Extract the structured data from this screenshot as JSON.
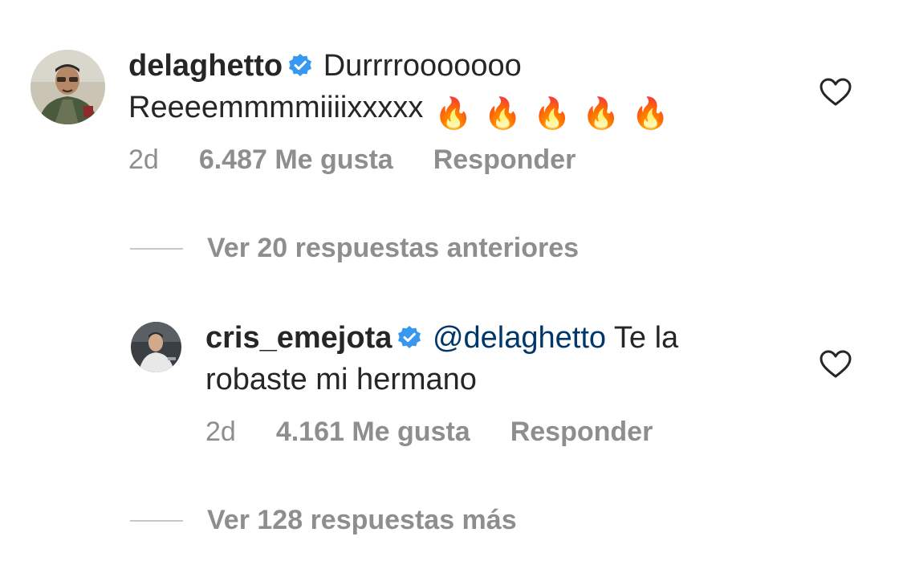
{
  "comments": [
    {
      "username": "delaghetto",
      "verified": true,
      "line1_text": "Durrrrooooooo",
      "line2_text": "Reeeemmmmiiiixxxxx",
      "emoji": [
        "🔥",
        "🔥",
        "🔥",
        "🔥",
        "🔥"
      ],
      "time": "2d",
      "likes": "6.487 Me gusta",
      "reply_label": "Responder"
    },
    {
      "username": "cris_emejota",
      "verified": true,
      "mention": "@delaghetto",
      "line1_text": "Te la",
      "line2_text": "robaste mi hermano",
      "time": "2d",
      "likes": "4.161 Me gusta",
      "reply_label": "Responder"
    }
  ],
  "replies_links": {
    "previous": "Ver 20 respuestas anteriores",
    "more": "Ver 128 respuestas más"
  },
  "colors": {
    "verified_blue": "#3897f0",
    "mention_blue": "#00376b",
    "meta_gray": "#8e8e8e"
  },
  "icons": {
    "like": "heart-outline-icon",
    "verified": "verified-badge-icon",
    "emoji": "fire-emoji"
  }
}
